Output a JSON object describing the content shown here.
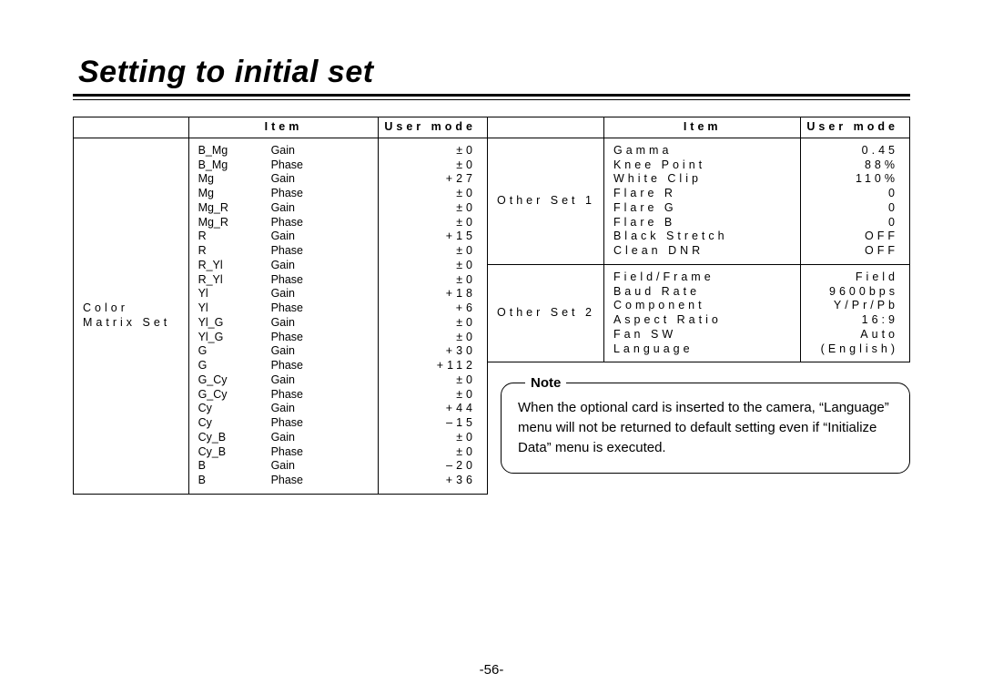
{
  "title": "Setting to initial set",
  "page_number": "-56-",
  "headers": {
    "blank": "",
    "item": "Item",
    "user_mode": "User mode"
  },
  "left": {
    "group": "Color\nMatrix Set",
    "items": [
      {
        "a": "B_Mg",
        "b": "Gain",
        "v": "±0"
      },
      {
        "a": "B_Mg",
        "b": "Phase",
        "v": "±0"
      },
      {
        "a": "Mg",
        "b": "Gain",
        "v": "+27"
      },
      {
        "a": "Mg",
        "b": "Phase",
        "v": "±0"
      },
      {
        "a": "Mg_R",
        "b": "Gain",
        "v": "±0"
      },
      {
        "a": "Mg_R",
        "b": "Phase",
        "v": "±0"
      },
      {
        "a": "R",
        "b": "Gain",
        "v": "+15"
      },
      {
        "a": "R",
        "b": "Phase",
        "v": "±0"
      },
      {
        "a": "R_Yl",
        "b": "Gain",
        "v": "±0"
      },
      {
        "a": "R_Yl",
        "b": "Phase",
        "v": "±0"
      },
      {
        "a": "Yl",
        "b": "Gain",
        "v": "+18"
      },
      {
        "a": "Yl",
        "b": "Phase",
        "v": "+6"
      },
      {
        "a": "Yl_G",
        "b": "Gain",
        "v": "±0"
      },
      {
        "a": "Yl_G",
        "b": "Phase",
        "v": "±0"
      },
      {
        "a": "G",
        "b": "Gain",
        "v": "+30"
      },
      {
        "a": "G",
        "b": "Phase",
        "v": "+112"
      },
      {
        "a": "G_Cy",
        "b": "Gain",
        "v": "±0"
      },
      {
        "a": "G_Cy",
        "b": "Phase",
        "v": "±0"
      },
      {
        "a": "Cy",
        "b": "Gain",
        "v": "+44"
      },
      {
        "a": "Cy",
        "b": "Phase",
        "v": "–15"
      },
      {
        "a": "Cy_B",
        "b": "Gain",
        "v": "±0"
      },
      {
        "a": "Cy_B",
        "b": "Phase",
        "v": "±0"
      },
      {
        "a": "B",
        "b": "Gain",
        "v": "–20"
      },
      {
        "a": "B",
        "b": "Phase",
        "v": "+36"
      }
    ]
  },
  "right1": {
    "group": "Other Set 1",
    "items": [
      {
        "a": "Gamma",
        "v": "0.45"
      },
      {
        "a": "Knee Point",
        "v": "88%"
      },
      {
        "a": "White Clip",
        "v": "110%"
      },
      {
        "a": "Flare R",
        "v": "0"
      },
      {
        "a": "Flare G",
        "v": "0"
      },
      {
        "a": "Flare B",
        "v": "0"
      },
      {
        "a": "Black Stretch",
        "v": "OFF"
      },
      {
        "a": "Clean DNR",
        "v": "OFF"
      }
    ]
  },
  "right2": {
    "group": "Other Set 2",
    "items": [
      {
        "a": "Field/Frame",
        "v": "Field"
      },
      {
        "a": "Baud Rate",
        "v": "9600bps"
      },
      {
        "a": "Component",
        "v": "Y/Pr/Pb"
      },
      {
        "a": "Aspect Ratio",
        "v": "16:9"
      },
      {
        "a": "Fan SW",
        "v": "Auto"
      },
      {
        "a": "Language",
        "v": "(English)"
      }
    ]
  },
  "note": {
    "label": "Note",
    "text": "When the optional card is inserted to the camera, “Language” menu will not be returned to default setting even if “Initialize Data” menu is executed."
  }
}
